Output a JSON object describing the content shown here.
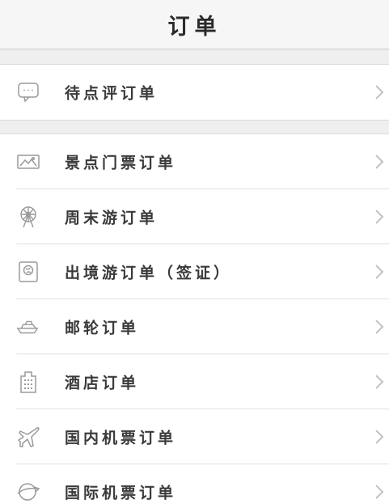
{
  "header": {
    "title": "订单"
  },
  "group1": {
    "items": [
      {
        "label": "待点评订单",
        "icon": "comment-icon"
      }
    ]
  },
  "group2": {
    "items": [
      {
        "label": "景点门票订单",
        "icon": "ticket-icon"
      },
      {
        "label": "周末游订单",
        "icon": "ferris-wheel-icon"
      },
      {
        "label": "出境游订单（签证）",
        "icon": "passport-icon"
      },
      {
        "label": "邮轮订单",
        "icon": "cruise-ship-icon"
      },
      {
        "label": "酒店订单",
        "icon": "hotel-icon"
      },
      {
        "label": "国内机票订单",
        "icon": "airplane-icon"
      },
      {
        "label": "国际机票订单",
        "icon": "globe-plane-icon"
      }
    ]
  },
  "colors": {
    "background": "#efefef",
    "header_bg": "#f6f6f6",
    "text": "#3a3a3a",
    "icon": "#9a9a9a",
    "chevron": "#c2c2c2"
  }
}
